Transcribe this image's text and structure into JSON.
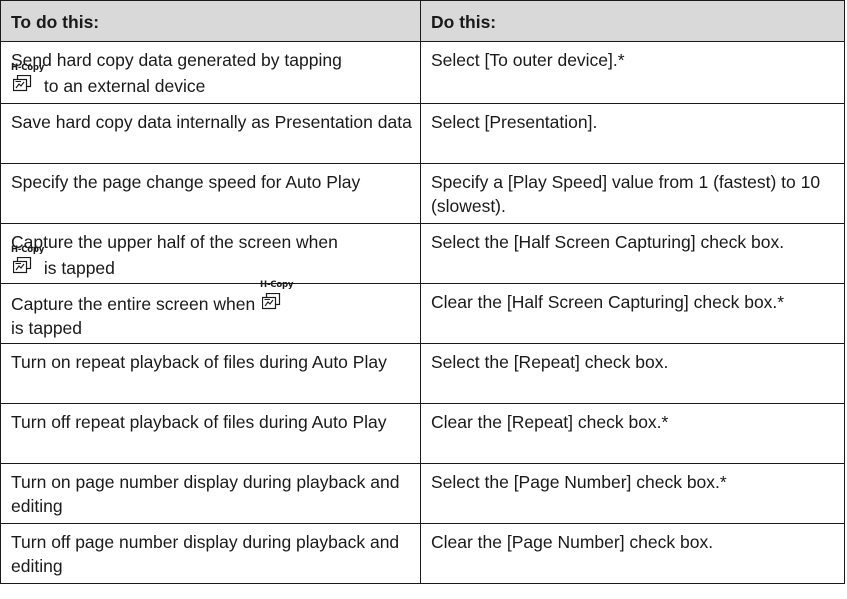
{
  "table": {
    "headers": [
      "To do this:",
      "Do this:"
    ],
    "icon_label": "H-Copy",
    "rows": [
      {
        "action_before": "Send hard copy data generated by tapping",
        "action_after": " to an external device",
        "instruction": "Select [To outer device].*"
      },
      {
        "action": "Save hard copy data internally as Presentation data",
        "instruction": "Select [Presentation]."
      },
      {
        "action": "Specify the page change speed for Auto Play",
        "instruction": "Specify a [Play Speed] value from 1 (fastest) to 10 (slowest)."
      },
      {
        "action_before": "Capture the upper half of the screen when",
        "action_after": " is tapped",
        "instruction": "Select the [Half Screen Capturing] check box."
      },
      {
        "action_before": "Capture the entire screen when",
        "action_after": "is tapped",
        "instruction": "Clear the [Half Screen Capturing] check box.*"
      },
      {
        "action": "Turn on repeat playback of files during Auto Play",
        "instruction": "Select the [Repeat] check box."
      },
      {
        "action": "Turn off repeat playback of files during Auto Play",
        "instruction": "Clear the [Repeat] check box.*"
      },
      {
        "action": "Turn on page number display during playback and editing",
        "instruction": "Select the [Page Number] check box.*"
      },
      {
        "action": "Turn off page number display during playback and editing",
        "instruction": "Clear the [Page Number] check box."
      }
    ]
  }
}
